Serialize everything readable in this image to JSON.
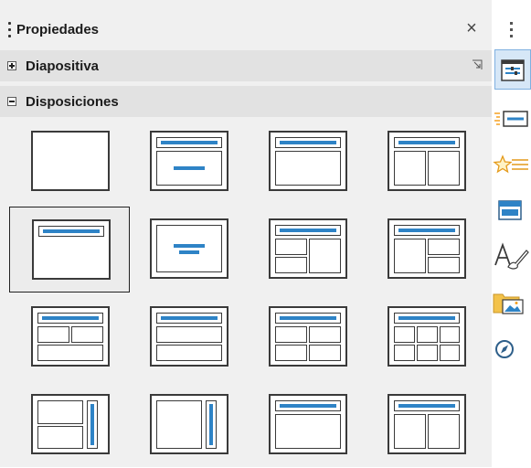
{
  "panel": {
    "title": "Propiedades",
    "close_glyph": "×"
  },
  "sections": {
    "slide": {
      "label": "Diapositiva",
      "state": "collapsed"
    },
    "layouts": {
      "label": "Disposiciones",
      "state": "expanded"
    }
  },
  "layout_grid": {
    "selected_index": 4,
    "accent_color": "#2e83c6"
  },
  "sidebar": {
    "menu_glyph": "⋮",
    "buttons": [
      {
        "icon": "properties-icon",
        "active": true
      },
      {
        "icon": "slide-transition-icon",
        "active": false
      },
      {
        "icon": "animation-icon",
        "active": false
      },
      {
        "icon": "master-slides-icon",
        "active": false
      },
      {
        "icon": "styles-icon",
        "active": false
      },
      {
        "icon": "gallery-icon",
        "active": false
      },
      {
        "icon": "navigator-icon",
        "active": false
      }
    ]
  }
}
